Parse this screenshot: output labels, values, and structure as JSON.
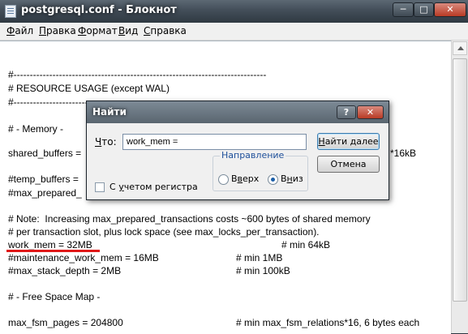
{
  "window": {
    "title": "postgresql.conf - Блокнот",
    "min_glyph": "─",
    "max_glyph": "□",
    "close_glyph": "✕"
  },
  "menu": [
    "Файл",
    "Правка",
    "Формат",
    "Вид",
    "Справка"
  ],
  "editor": {
    "lines": [
      "#------------------------------------------------------------------------------",
      "# RESOURCE USAGE (except WAL)",
      "#------------------------------------------------------------------------------",
      "",
      "# - Memory -",
      "",
      "shared_buffers =",
      "",
      "#temp_buffers =",
      "#max_prepared_",
      "",
      "# Note:  Increasing max_prepared_transactions costs ~600 bytes of shared memory",
      "# per transaction slot, plus lock space (see max_locks_per_transaction).",
      "work_mem = 32MB",
      "#maintenance_work_mem = 16MB",
      "#max_stack_depth = 2MB",
      "",
      "# - Free Space Map -",
      "",
      "max_fsm_pages = 204800"
    ],
    "comments": {
      "shared_buffers": "*16kB",
      "work_mem": "# min 64kB",
      "maintenance_work_mem": "# min 1MB",
      "max_stack_depth": "# min 100kB",
      "max_fsm_pages": "# min max_fsm_relations*16, 6 bytes each"
    },
    "highlight_color": "#e01818"
  },
  "find_dialog": {
    "title": "Найти",
    "help_glyph": "?",
    "close_glyph": "✕",
    "find_label": "Что:",
    "find_value": "work_mem =",
    "find_next_label": "Найти далее",
    "cancel_label": "Отмена",
    "direction_label": "Направление",
    "up_label": "Вверх",
    "down_label": "Вниз",
    "direction_selected": "Вниз",
    "match_case_label": "С учетом регистра",
    "match_case_checked": false
  }
}
